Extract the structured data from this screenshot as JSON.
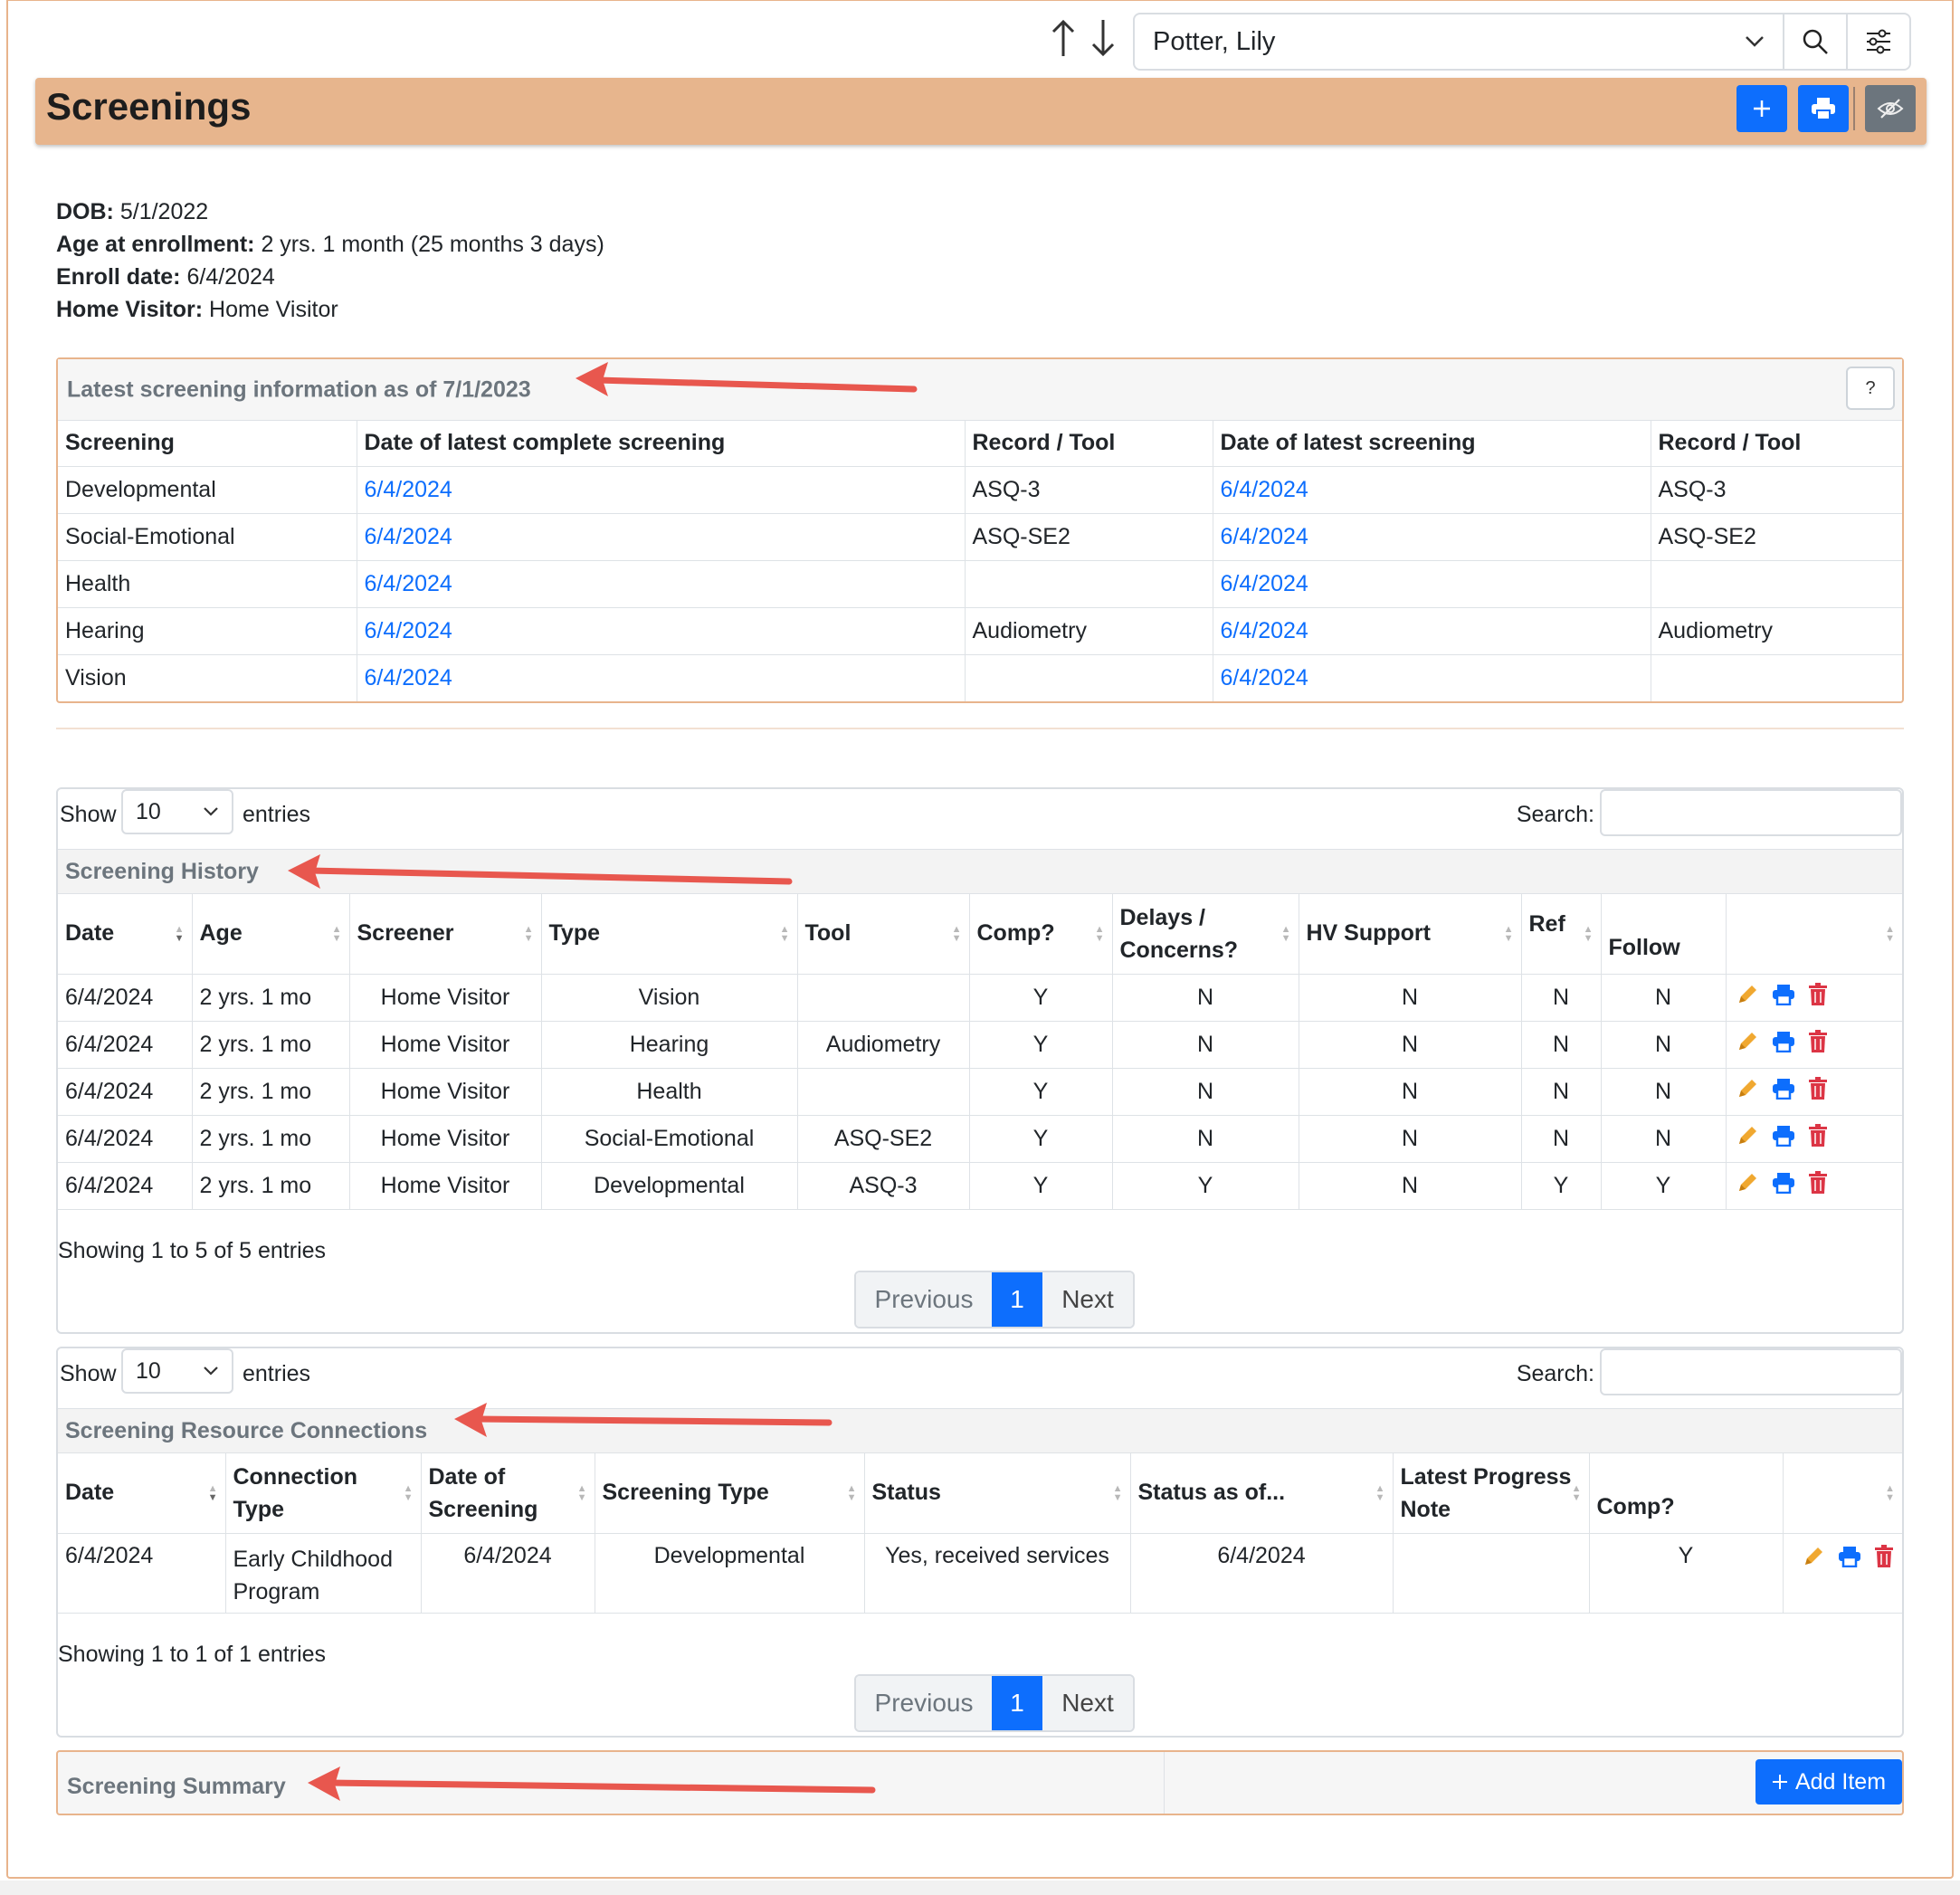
{
  "nav": {
    "up_icon": "arrow-up-icon",
    "down_icon": "arrow-down-icon",
    "client_name": "Potter, Lily"
  },
  "header": {
    "title": "Screenings"
  },
  "demographics": [
    {
      "label": "DOB:",
      "value": "5/1/2022"
    },
    {
      "label": "Age at enrollment:",
      "value": "2 yrs. 1 month (25 months 3 days)"
    },
    {
      "label": "Enroll date:",
      "value": "6/4/2024"
    },
    {
      "label": "Home Visitor:",
      "value": "Home Visitor"
    }
  ],
  "latest": {
    "title": "Latest screening information as of 7/1/2023",
    "help_label": "?",
    "columns": [
      "Screening",
      "Date of latest complete screening",
      "Record / Tool",
      "Date of latest screening",
      "Record / Tool"
    ],
    "rows": [
      [
        "Developmental",
        "6/4/2024",
        "ASQ-3",
        "6/4/2024",
        "ASQ-3"
      ],
      [
        "Social-Emotional",
        "6/4/2024",
        "ASQ-SE2",
        "6/4/2024",
        "ASQ-SE2"
      ],
      [
        "Health",
        "6/4/2024",
        "",
        "6/4/2024",
        ""
      ],
      [
        "Hearing",
        "6/4/2024",
        "Audiometry",
        "6/4/2024",
        "Audiometry"
      ],
      [
        "Vision",
        "6/4/2024",
        "",
        "6/4/2024",
        ""
      ]
    ]
  },
  "history": {
    "show_label": "Show",
    "length": "10",
    "entries_label": "entries",
    "search_label": "Search:",
    "caption": "Screening History",
    "columns": [
      "Date",
      "Age",
      "Screener",
      "Type",
      "Tool",
      "Comp?",
      "Delays / Concerns?",
      "HV Support",
      "Ref",
      "Follow",
      ""
    ],
    "rows": [
      [
        "6/4/2024",
        "2 yrs. 1 mo",
        "Home Visitor",
        "Vision",
        "",
        "Y",
        "N",
        "N",
        "N",
        "N"
      ],
      [
        "6/4/2024",
        "2 yrs. 1 mo",
        "Home Visitor",
        "Hearing",
        "Audiometry",
        "Y",
        "N",
        "N",
        "N",
        "N"
      ],
      [
        "6/4/2024",
        "2 yrs. 1 mo",
        "Home Visitor",
        "Health",
        "",
        "Y",
        "N",
        "N",
        "N",
        "N"
      ],
      [
        "6/4/2024",
        "2 yrs. 1 mo",
        "Home Visitor",
        "Social-Emotional",
        "ASQ-SE2",
        "Y",
        "N",
        "N",
        "N",
        "N"
      ],
      [
        "6/4/2024",
        "2 yrs. 1 mo",
        "Home Visitor",
        "Developmental",
        "ASQ-3",
        "Y",
        "Y",
        "N",
        "Y",
        "Y"
      ]
    ],
    "info": "Showing 1 to 5 of 5 entries",
    "pager": {
      "prev": "Previous",
      "page": "1",
      "next": "Next"
    }
  },
  "connections": {
    "show_label": "Show",
    "length": "10",
    "entries_label": "entries",
    "search_label": "Search:",
    "caption": "Screening Resource Connections",
    "columns": [
      "Date",
      "Connection Type",
      "Date of Screening",
      "Screening Type",
      "Status",
      "Status as of...",
      "Latest Progress Note",
      "Comp?",
      ""
    ],
    "rows": [
      [
        "6/4/2024",
        "Early Childhood Program",
        "6/4/2024",
        "Developmental",
        "Yes, received services",
        "6/4/2024",
        "",
        "Y"
      ]
    ],
    "info": "Showing 1 to 1 of 1 entries",
    "pager": {
      "prev": "Previous",
      "page": "1",
      "next": "Next"
    }
  },
  "summary": {
    "title": "Screening Summary",
    "add_label": "Add Item"
  },
  "colors": {
    "header": "#e7b58d",
    "accent": "#0d6efd",
    "arrow": "#e8574e",
    "edit": "#f0a830",
    "delete": "#dc3545"
  }
}
